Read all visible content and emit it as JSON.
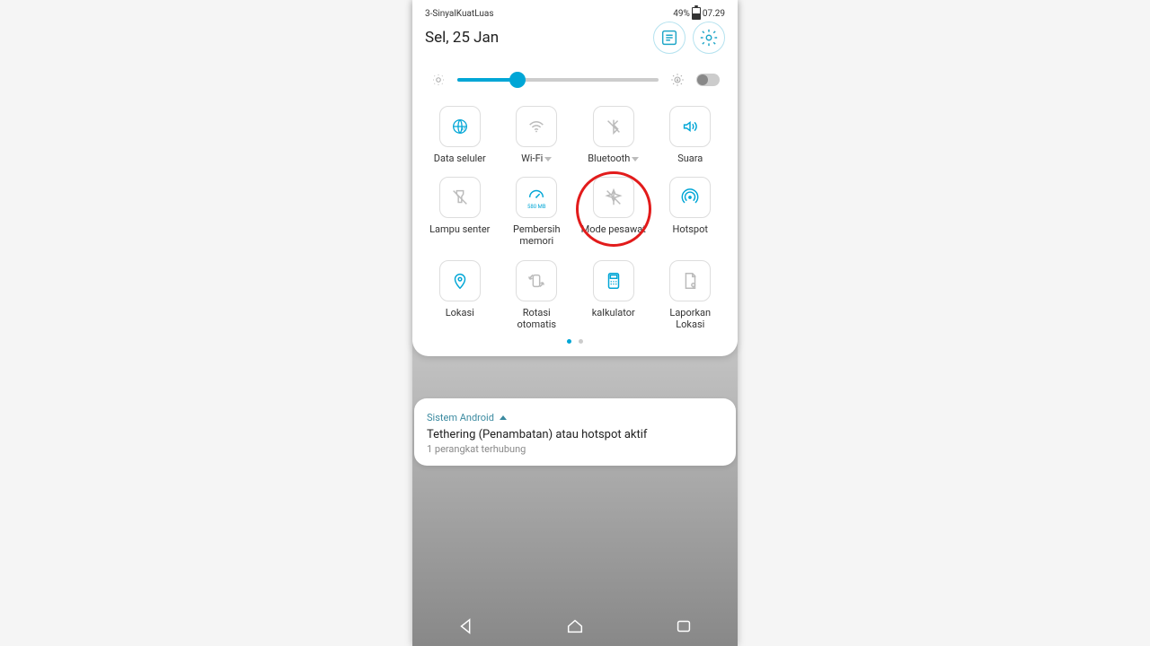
{
  "status": {
    "carrier": "3-SinyalKuatLuas",
    "battery_pct": "49%",
    "time": "07.29"
  },
  "header": {
    "date": "Sel, 25 Jan"
  },
  "brightness": {
    "percent": 30,
    "auto": false
  },
  "tiles": [
    {
      "id": "mobile-data",
      "label": "Data seluler",
      "on": true,
      "dropdown": false,
      "icon": "globe"
    },
    {
      "id": "wifi",
      "label": "Wi-Fi",
      "on": false,
      "dropdown": true,
      "icon": "wifi"
    },
    {
      "id": "bluetooth",
      "label": "Bluetooth",
      "on": false,
      "dropdown": true,
      "icon": "bluetooth-off"
    },
    {
      "id": "sound",
      "label": "Suara",
      "on": true,
      "dropdown": false,
      "icon": "sound"
    },
    {
      "id": "flashlight",
      "label": "Lampu senter",
      "on": false,
      "dropdown": false,
      "icon": "flashlight"
    },
    {
      "id": "memclean",
      "label": "Pembersih memori",
      "on": true,
      "dropdown": false,
      "icon": "gauge",
      "subtext": "580 MB"
    },
    {
      "id": "airplane",
      "label": "Mode pesawat",
      "on": false,
      "dropdown": false,
      "icon": "airplane",
      "highlight": true
    },
    {
      "id": "hotspot",
      "label": "Hotspot",
      "on": true,
      "dropdown": false,
      "icon": "hotspot"
    },
    {
      "id": "location",
      "label": "Lokasi",
      "on": true,
      "dropdown": false,
      "icon": "pin"
    },
    {
      "id": "autorotate",
      "label": "Rotasi otomatis",
      "on": false,
      "dropdown": false,
      "icon": "rotate"
    },
    {
      "id": "calculator",
      "label": "kalkulator",
      "on": true,
      "dropdown": false,
      "icon": "calc"
    },
    {
      "id": "reportloc",
      "label": "Laporkan Lokasi",
      "on": false,
      "dropdown": false,
      "icon": "docpin"
    }
  ],
  "pager": {
    "pages": 2,
    "active": 0
  },
  "notification": {
    "app": "Sistem Android",
    "title": "Tethering (Penambatan) atau hotspot aktif",
    "subtitle": "1 perangkat terhubung"
  }
}
